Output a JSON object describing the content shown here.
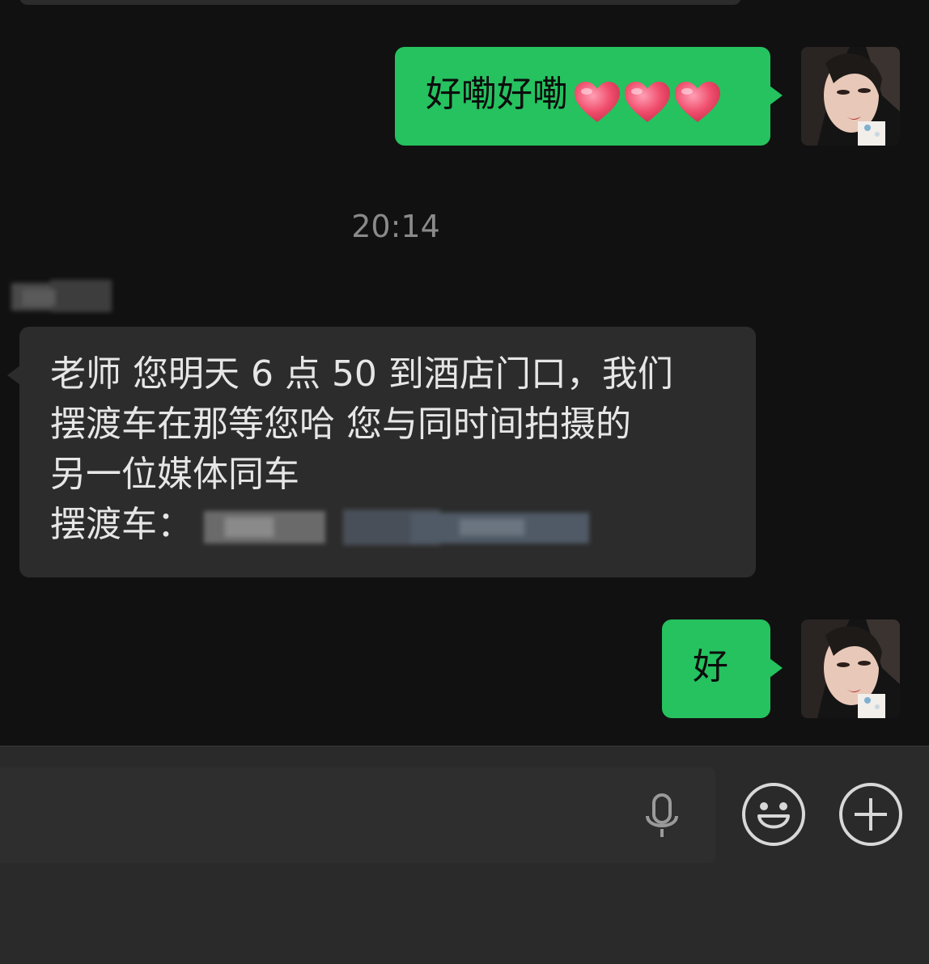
{
  "messages": {
    "outgoing_1": {
      "text": "好嘞好嘞",
      "emoji": [
        "red-heart",
        "red-heart",
        "red-heart"
      ]
    },
    "timestamp": "20:14",
    "incoming_1": {
      "line1": "老师 您明天 6 点 50 到酒店门口，我们",
      "line2": "摆渡车在那等您哈 您与同时间拍摄的",
      "line3": "另一位媒体同车",
      "line4_label": "摆渡车："
    },
    "outgoing_2": {
      "text": "好"
    }
  },
  "input_bar": {
    "voice_icon": "microphone-icon",
    "emoji_icon": "smiley-face-icon",
    "more_icon": "plus-circle-icon"
  },
  "colors": {
    "background": "#111111",
    "outgoing_bubble": "#25c25f",
    "incoming_bubble": "#2c2c2c",
    "input_bar": "#2a2a2a"
  }
}
